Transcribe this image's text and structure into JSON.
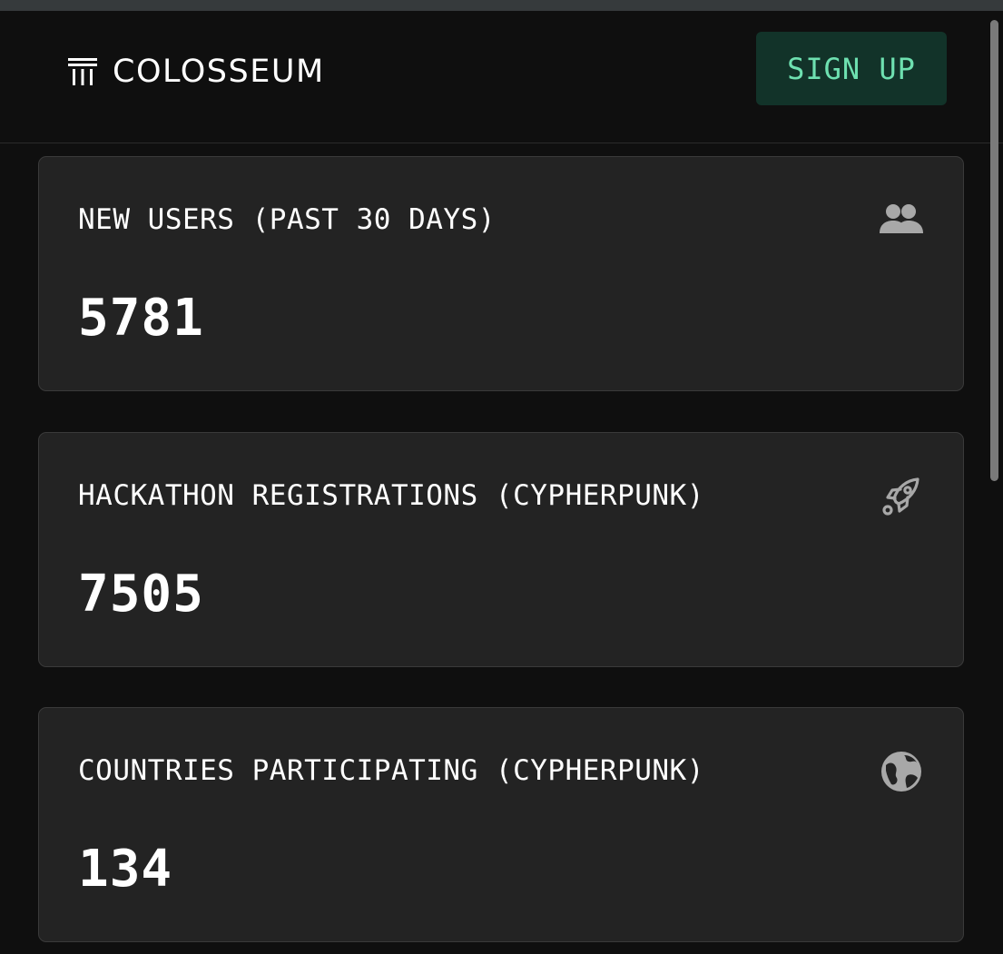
{
  "header": {
    "logo_text": "COLOSSEUM",
    "logo_icon": "colosseum-pillars-icon",
    "signup_label": "SIGN UP"
  },
  "stats": [
    {
      "label": "NEW USERS (PAST 30 DAYS)",
      "value": "5781",
      "icon": "users-icon"
    },
    {
      "label": "HACKATHON REGISTRATIONS (CYPHERPUNK)",
      "value": "7505",
      "icon": "rocket-icon"
    },
    {
      "label": "COUNTRIES PARTICIPATING (CYPHERPUNK)",
      "value": "134",
      "icon": "globe-icon"
    }
  ],
  "colors": {
    "background": "#0f0f0f",
    "card": "#232323",
    "accent_text": "#6ee0b0",
    "accent_bg": "#123329",
    "icon": "#a8a8a8"
  }
}
